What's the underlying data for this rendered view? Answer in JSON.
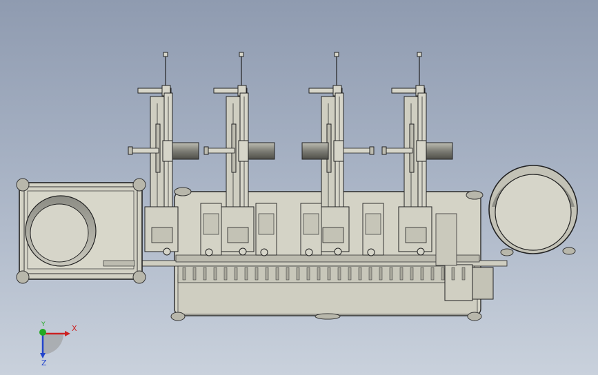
{
  "viewport": {
    "background_top": "#8f9bb0",
    "background_bottom": "#c9d1dc",
    "part_fill": "#d6d5c9",
    "part_shade": "#a9a99c",
    "edge_color": "#2a2a2a"
  },
  "triad": {
    "x_label": "X",
    "y_label": "Y",
    "z_label": "Z",
    "x_color": "#cc2222",
    "y_color": "#22aa22",
    "z_color": "#2244cc"
  },
  "model": {
    "press_units": 4,
    "left_feeder": "square-reel-icon",
    "right_feeder": "round-reel-icon"
  }
}
